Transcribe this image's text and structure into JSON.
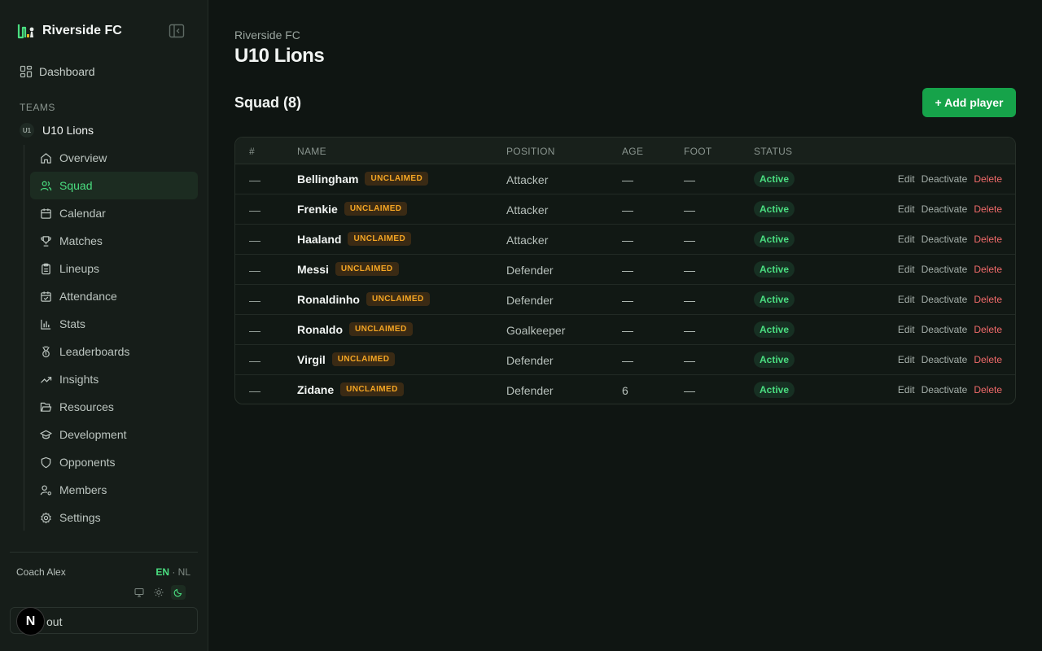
{
  "brand": {
    "name": "Riverside FC"
  },
  "nav": {
    "dashboard": "Dashboard",
    "section": "TEAMS"
  },
  "team": {
    "badge": "U1",
    "name": "U10 Lions"
  },
  "sidebar_items": [
    {
      "label": "Overview",
      "icon": "home-icon"
    },
    {
      "label": "Squad",
      "icon": "users-icon",
      "active": true
    },
    {
      "label": "Calendar",
      "icon": "calendar-icon"
    },
    {
      "label": "Matches",
      "icon": "trophy-icon"
    },
    {
      "label": "Lineups",
      "icon": "clipboard-icon"
    },
    {
      "label": "Attendance",
      "icon": "calendar-check-icon"
    },
    {
      "label": "Stats",
      "icon": "bar-chart-icon"
    },
    {
      "label": "Leaderboards",
      "icon": "medal-icon"
    },
    {
      "label": "Insights",
      "icon": "trending-up-icon"
    },
    {
      "label": "Resources",
      "icon": "folder-icon"
    },
    {
      "label": "Development",
      "icon": "graduation-cap-icon"
    },
    {
      "label": "Opponents",
      "icon": "shield-icon"
    },
    {
      "label": "Members",
      "icon": "user-cog-icon"
    },
    {
      "label": "Settings",
      "icon": "gear-icon"
    }
  ],
  "user": {
    "name": "Coach Alex",
    "lang_en": "EN",
    "lang_sep": " · ",
    "lang_nl": "NL",
    "logout_label": "out",
    "next_badge": "N"
  },
  "page": {
    "breadcrumb": "Riverside FC",
    "title": "U10 Lions"
  },
  "squad": {
    "title": "Squad (8)",
    "add_label": "+ Add player"
  },
  "table": {
    "headers": {
      "num": "#",
      "name": "NAME",
      "position": "POSITION",
      "age": "AGE",
      "foot": "FOOT",
      "status": "STATUS"
    },
    "rows": [
      {
        "num": "—",
        "name": "Bellingham",
        "badge": "UNCLAIMED",
        "position": "Attacker",
        "age": "—",
        "foot": "—",
        "status": "Active"
      },
      {
        "num": "—",
        "name": "Frenkie",
        "badge": "UNCLAIMED",
        "position": "Attacker",
        "age": "—",
        "foot": "—",
        "status": "Active"
      },
      {
        "num": "—",
        "name": "Haaland",
        "badge": "UNCLAIMED",
        "position": "Attacker",
        "age": "—",
        "foot": "—",
        "status": "Active"
      },
      {
        "num": "—",
        "name": "Messi",
        "badge": "UNCLAIMED",
        "position": "Defender",
        "age": "—",
        "foot": "—",
        "status": "Active"
      },
      {
        "num": "—",
        "name": "Ronaldinho",
        "badge": "UNCLAIMED",
        "position": "Defender",
        "age": "—",
        "foot": "—",
        "status": "Active"
      },
      {
        "num": "—",
        "name": "Ronaldo",
        "badge": "UNCLAIMED",
        "position": "Goalkeeper",
        "age": "—",
        "foot": "—",
        "status": "Active"
      },
      {
        "num": "—",
        "name": "Virgil",
        "badge": "UNCLAIMED",
        "position": "Defender",
        "age": "—",
        "foot": "—",
        "status": "Active"
      },
      {
        "num": "—",
        "name": "Zidane",
        "badge": "UNCLAIMED",
        "position": "Defender",
        "age": "6",
        "foot": "—",
        "status": "Active"
      }
    ],
    "actions": {
      "edit": "Edit",
      "deactivate": "Deactivate",
      "delete": "Delete"
    }
  },
  "colors": {
    "accent": "#4ade80",
    "primary_button": "#16a34a",
    "danger": "#f26b6b",
    "badge": "#f5a623",
    "background": "#0f1512",
    "sidebar": "#161d19"
  }
}
